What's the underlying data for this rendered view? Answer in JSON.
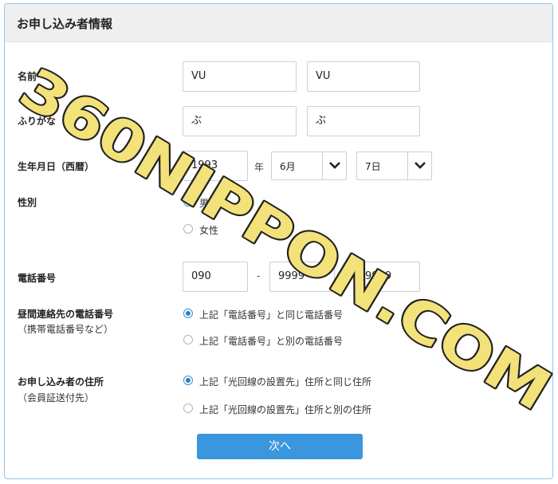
{
  "form": {
    "title": "お申し込み者情報",
    "name": {
      "label": "名前",
      "last": "VU",
      "first": "VU"
    },
    "kana": {
      "label": "ふりがな",
      "last": "ぶ",
      "first": "ぶ"
    },
    "birth": {
      "label": "生年月日（西暦）",
      "year": "1993",
      "year_unit": "年",
      "month": "6月",
      "day": "7日"
    },
    "gender": {
      "label": "性別",
      "options": [
        {
          "label": "男性",
          "checked": true
        },
        {
          "label": "女性",
          "checked": false
        }
      ]
    },
    "phone": {
      "label": "電話番号",
      "part1": "090",
      "part2": "9999",
      "part3": "9999",
      "separator": "-"
    },
    "daytime_phone": {
      "label": "昼間連絡先の電話番号",
      "sublabel": "（携帯電話番号など）",
      "options": [
        {
          "label": "上記「電話番号」と同じ電話番号",
          "checked": true
        },
        {
          "label": "上記「電話番号」と別の電話番号",
          "checked": false
        }
      ]
    },
    "address": {
      "label": "お申し込み者の住所",
      "sublabel": "（会員証送付先）",
      "options": [
        {
          "label": "上記「光回線の設置先」住所と同じ住所",
          "checked": true
        },
        {
          "label": "上記「光回線の設置先」住所と別の住所",
          "checked": false
        }
      ]
    },
    "next_label": "次へ"
  },
  "watermark": {
    "text": "360NIPPON.COM",
    "color": "#f3e27a"
  },
  "colors": {
    "accent": "#3a97dd",
    "border": "#8fc7ea"
  }
}
